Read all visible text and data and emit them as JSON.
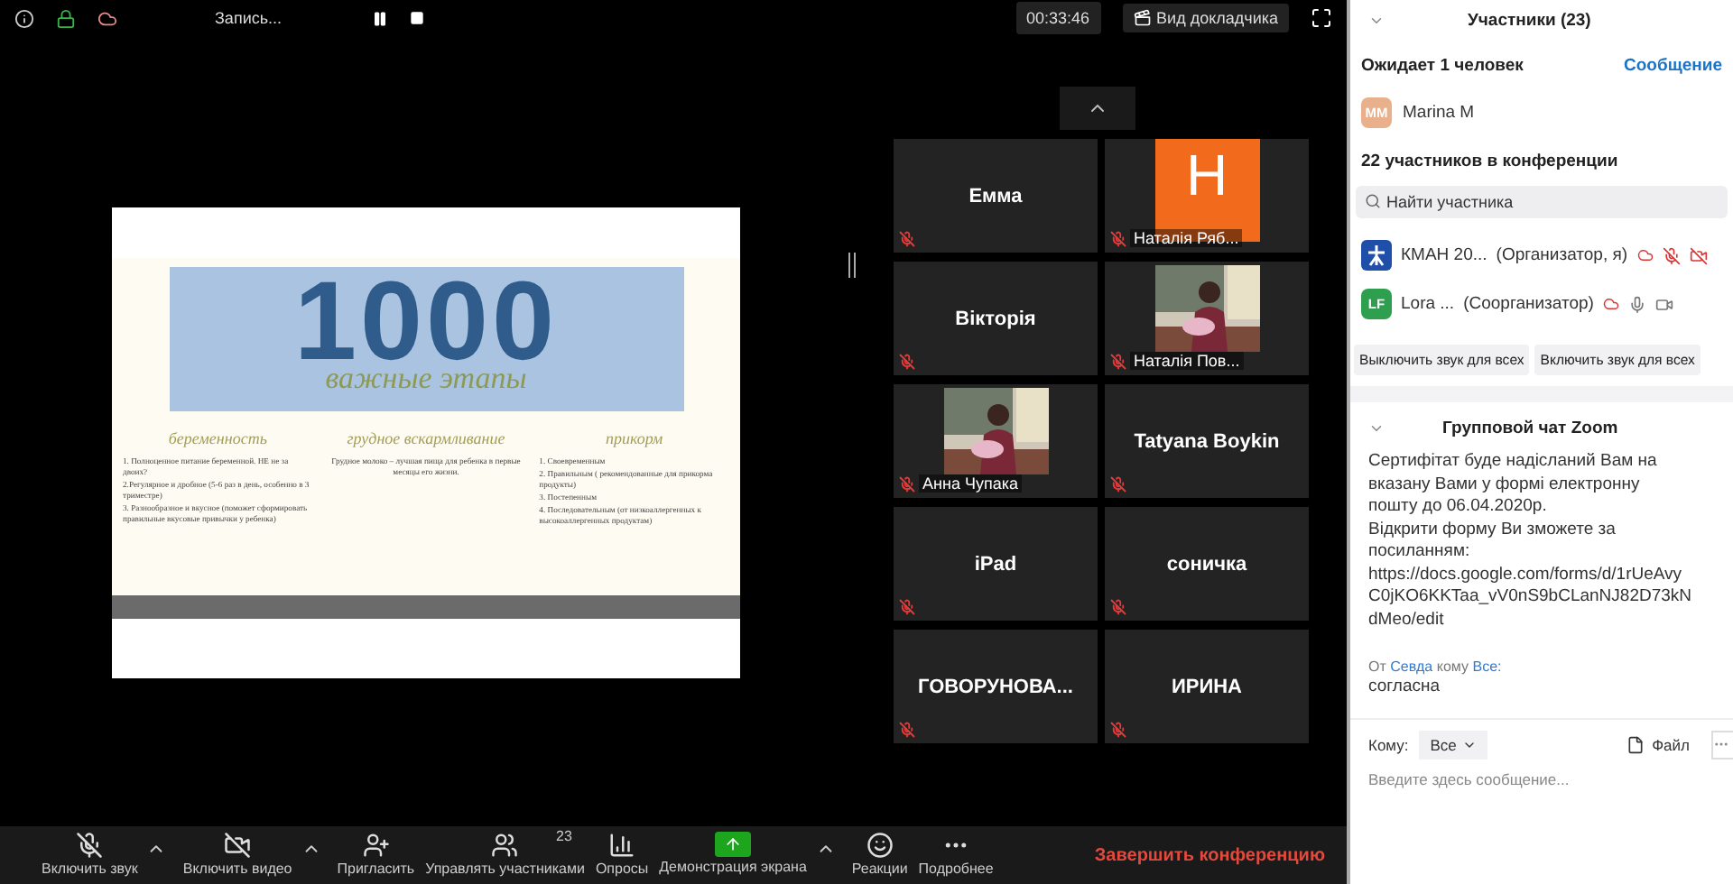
{
  "top_bar": {
    "recording_label": "Запись...",
    "timer": "00:33:46",
    "view_button": "Вид докладчика"
  },
  "slide": {
    "number": "1000",
    "subtitle": "важные этапы",
    "columns": [
      {
        "heading": "беременность",
        "lines": [
          "1. Полноценное питание беременной. НЕ не за двоих?",
          "2.Регулярное и дробное (5-6 раз в день, особенно в 3 триместре)",
          "3. Разнообразное и вкусное (поможет сформировать правильные вкусовые привычки у ребенка)"
        ]
      },
      {
        "heading": "грудное вскармливание",
        "lines": [
          "Грудное молоко – лучшая пища для ребенка в первые месяцы его жизни."
        ]
      },
      {
        "heading": "прикорм",
        "lines": [
          "1. Своевременным",
          "2. Правильным ( рекомендованные для прикорма продукты)",
          "3. Постепенным",
          "4. Последовательным (от низкоаллергенных к высокоаллергенных продуктам)"
        ]
      }
    ]
  },
  "video_grid": {
    "tiles": [
      {
        "kind": "name",
        "name": "Емма",
        "muted": true
      },
      {
        "kind": "avatar",
        "initial": "H",
        "name": "Наталія Ряб...",
        "muted": true
      },
      {
        "kind": "name",
        "name": "Вікторія",
        "muted": true
      },
      {
        "kind": "video",
        "name": "Наталія Пов...",
        "muted": true
      },
      {
        "kind": "video",
        "name": "Анна Чупака",
        "muted": true
      },
      {
        "kind": "name",
        "name": "Tatyana Boykin",
        "muted": true
      },
      {
        "kind": "name",
        "name": "iPad",
        "muted": true
      },
      {
        "kind": "name",
        "name": "соничка",
        "muted": true
      },
      {
        "kind": "name",
        "name": "ГОВОРУНОВА...",
        "muted": true
      },
      {
        "kind": "name",
        "name": "ИРИНА",
        "muted": true
      }
    ]
  },
  "toolbar": {
    "items": [
      {
        "kind": "mic",
        "label": "Включить звук",
        "off": true,
        "caret": true
      },
      {
        "kind": "video",
        "label": "Включить видео",
        "off": true,
        "caret": true
      },
      {
        "kind": "invite",
        "label": "Пригласить",
        "caret": false
      },
      {
        "kind": "participants",
        "label": "Управлять участниками",
        "count": "23",
        "caret": false
      },
      {
        "kind": "polls",
        "label": "Опросы",
        "caret": false
      },
      {
        "kind": "share",
        "label": "Демонстрация экрана",
        "caret": true
      },
      {
        "kind": "reactions",
        "label": "Реакции",
        "caret": false
      },
      {
        "kind": "more",
        "label": "Подробнее",
        "caret": false
      }
    ],
    "end_button": "Завершить конференцию"
  },
  "participants_panel": {
    "title": "Участники (23)",
    "waiting_label": "Ожидает 1 человек",
    "message_link": "Сообщение",
    "waiting": [
      {
        "initials": "MM",
        "name": "Marina M"
      }
    ],
    "in_meeting_label": "22 участников в конференции",
    "search": {
      "placeholder": "Найти участника"
    },
    "participants": [
      {
        "kind": "logo",
        "name": "КМАН 20...",
        "role": "(Организатор, я)",
        "mic_muted": true,
        "video_off": true
      },
      {
        "kind": "initials",
        "initials": "LF",
        "name": "Lora ...",
        "role": "(Соорганизатор)",
        "mic_muted": false,
        "video_off": false
      }
    ],
    "buttons": [
      "Выключить звук для всех",
      "Включить звук для всех"
    ]
  },
  "chat": {
    "title": "Групповой чат Zoom",
    "messages": [
      {
        "lines": [
          "Сертифітат буде надісланий Вам на вказану Вами у формі електронну пошту до 06.04.2020р.",
          "Відкрити форму Ви зможете за посиланням:",
          "https://docs.google.com/forms/d/1rUeAvyC0jKO6KKTaa_vV0nS9bCLanNJ82D73kNdMeo/edit"
        ]
      },
      {
        "from_label": "От",
        "sender": "Севда",
        "to_label": "кому",
        "recipient": "Все:",
        "lines": [
          "согласна"
        ]
      }
    ],
    "to_label": "Кому:",
    "recipient": "Все",
    "file_button": "Файл",
    "input": {
      "placeholder": "Введите здесь сообщение..."
    }
  }
}
